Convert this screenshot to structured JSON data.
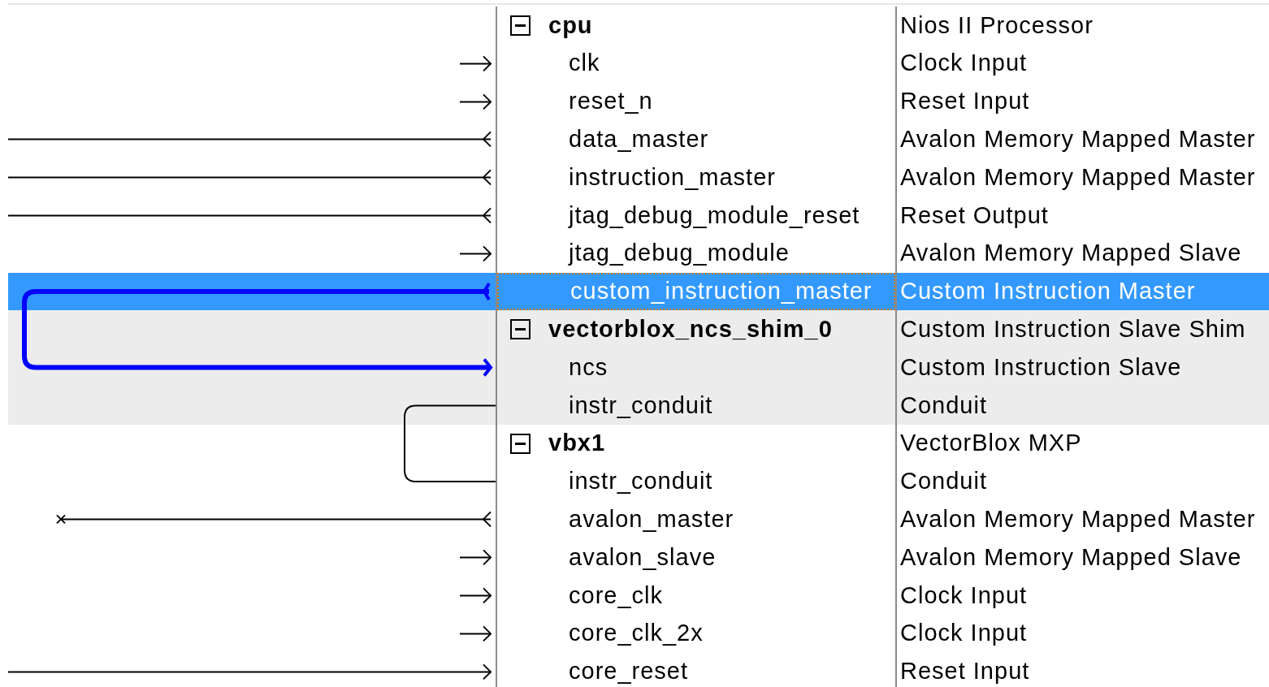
{
  "rows": [
    {
      "kind": "module",
      "name": "cpu",
      "description": "Nios II Processor",
      "expanded": true,
      "selected": false,
      "shaded": false
    },
    {
      "kind": "interface",
      "name": "clk",
      "description": "Clock Input",
      "connection": {
        "kind": "export_in"
      },
      "selected": false,
      "shaded": false
    },
    {
      "kind": "interface",
      "name": "reset_n",
      "description": "Reset Input",
      "connection": {
        "kind": "export_in"
      },
      "selected": false,
      "shaded": false
    },
    {
      "kind": "interface",
      "name": "data_master",
      "description": "Avalon Memory Mapped Master",
      "connection": {
        "kind": "line_out"
      },
      "selected": false,
      "shaded": false
    },
    {
      "kind": "interface",
      "name": "instruction_master",
      "description": "Avalon Memory Mapped Master",
      "connection": {
        "kind": "line_out"
      },
      "selected": false,
      "shaded": false
    },
    {
      "kind": "interface",
      "name": "jtag_debug_module_reset",
      "description": "Reset Output",
      "connection": {
        "kind": "line_out"
      },
      "selected": false,
      "shaded": false
    },
    {
      "kind": "interface",
      "name": "jtag_debug_module",
      "description": "Avalon Memory Mapped Slave",
      "connection": {
        "kind": "export_in"
      },
      "selected": false,
      "shaded": false
    },
    {
      "kind": "interface",
      "name": "custom_instruction_master",
      "description": "Custom Instruction Master",
      "connection": {
        "kind": "link_start",
        "selected": true
      },
      "selected": true
    },
    {
      "kind": "module",
      "name": "vectorblox_ncs_shim_0",
      "description": "Custom Instruction Slave Shim",
      "expanded": true,
      "selected": false,
      "shaded": true
    },
    {
      "kind": "interface",
      "name": "ncs",
      "description": "Custom Instruction Slave",
      "connection": {
        "kind": "link_end"
      },
      "selected": false,
      "shaded": true
    },
    {
      "kind": "interface",
      "name": "instr_conduit",
      "description": "Conduit",
      "connection": {
        "kind": "conduit_start",
        "selected": false
      },
      "selected": false,
      "shaded": true
    },
    {
      "kind": "module",
      "name": "vbx1",
      "description": "VectorBlox MXP",
      "expanded": true,
      "selected": false,
      "shaded": false
    },
    {
      "kind": "interface",
      "name": "instr_conduit",
      "description": "Conduit",
      "connection": {
        "kind": "conduit_end"
      },
      "selected": false,
      "shaded": false
    },
    {
      "kind": "interface",
      "name": "avalon_master",
      "description": "Avalon Memory Mapped Master",
      "connection": {
        "kind": "unconnected_out"
      },
      "selected": false,
      "shaded": false
    },
    {
      "kind": "interface",
      "name": "avalon_slave",
      "description": "Avalon Memory Mapped Slave",
      "connection": {
        "kind": "export_in"
      },
      "selected": false,
      "shaded": false
    },
    {
      "kind": "interface",
      "name": "core_clk",
      "description": "Clock Input",
      "connection": {
        "kind": "export_in"
      },
      "selected": false,
      "shaded": false
    },
    {
      "kind": "interface",
      "name": "core_clk_2x",
      "description": "Clock Input",
      "connection": {
        "kind": "export_in"
      },
      "selected": false,
      "shaded": false
    },
    {
      "kind": "interface",
      "name": "core_reset",
      "description": "Reset Input",
      "connection": {
        "kind": "line_in"
      },
      "selected": false,
      "shaded": false
    }
  ]
}
